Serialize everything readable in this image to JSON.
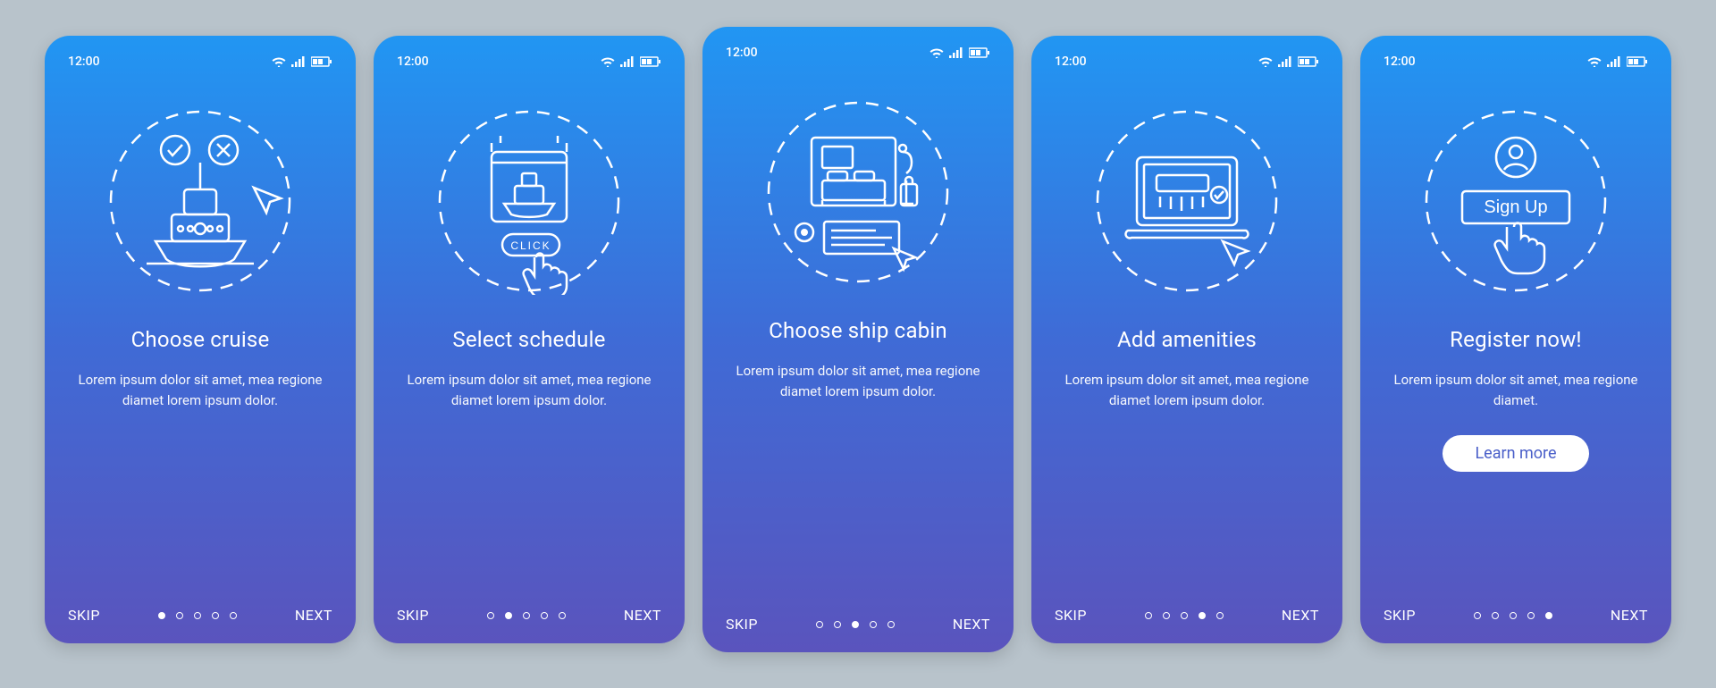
{
  "status": {
    "time": "12:00"
  },
  "nav": {
    "skip": "SKIP",
    "next": "NEXT"
  },
  "total_steps": 5,
  "screens": [
    {
      "title": "Choose cruise",
      "desc": "Lorem ipsum dolor sit amet, mea regione diamet lorem ipsum dolor."
    },
    {
      "title": "Select schedule",
      "desc": "Lorem ipsum dolor sit amet, mea regione diamet lorem ipsum dolor."
    },
    {
      "title": "Choose ship cabin",
      "desc": "Lorem ipsum dolor sit amet, mea regione diamet lorem ipsum dolor."
    },
    {
      "title": "Add amenities",
      "desc": "Lorem ipsum dolor sit amet, mea regione diamet lorem ipsum dolor."
    },
    {
      "title": "Register now!",
      "desc": "Lorem ipsum dolor sit amet, mea regione diamet.",
      "cta": "Learn more",
      "signup_label": "Sign Up"
    }
  ],
  "illustration_labels": {
    "click_button": "CLICK"
  }
}
